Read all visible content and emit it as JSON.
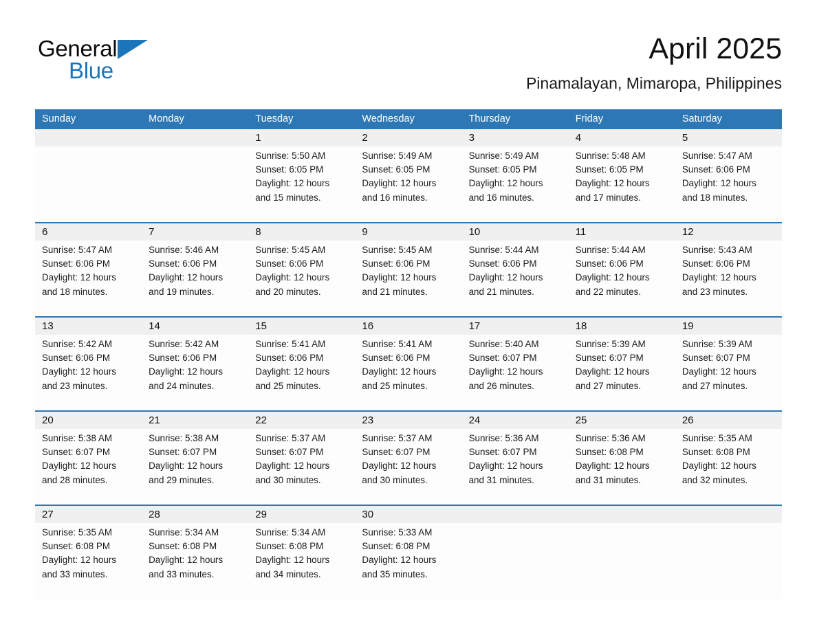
{
  "brand": {
    "name_part1": "General",
    "name_part2": "Blue",
    "triangle_icon": "triangle-icon",
    "color_black": "#0b0b0b",
    "color_blue": "#1b75bb"
  },
  "header": {
    "title": "April 2025",
    "subtitle": "Pinamalayan, Mimaropa, Philippines"
  },
  "theme": {
    "header_bg": "#2e77b5",
    "header_text": "#ffffff",
    "datestrip_bg": "#f0f0f0",
    "cell_bg": "#fdfdfd",
    "rule_color": "#2e77b5"
  },
  "weekdays": [
    "Sunday",
    "Monday",
    "Tuesday",
    "Wednesday",
    "Thursday",
    "Friday",
    "Saturday"
  ],
  "weeks": [
    {
      "days": [
        {
          "num": "",
          "lines": []
        },
        {
          "num": "",
          "lines": []
        },
        {
          "num": "1",
          "lines": [
            "Sunrise: 5:50 AM",
            "Sunset: 6:05 PM",
            "Daylight: 12 hours",
            "and 15 minutes."
          ]
        },
        {
          "num": "2",
          "lines": [
            "Sunrise: 5:49 AM",
            "Sunset: 6:05 PM",
            "Daylight: 12 hours",
            "and 16 minutes."
          ]
        },
        {
          "num": "3",
          "lines": [
            "Sunrise: 5:49 AM",
            "Sunset: 6:05 PM",
            "Daylight: 12 hours",
            "and 16 minutes."
          ]
        },
        {
          "num": "4",
          "lines": [
            "Sunrise: 5:48 AM",
            "Sunset: 6:05 PM",
            "Daylight: 12 hours",
            "and 17 minutes."
          ]
        },
        {
          "num": "5",
          "lines": [
            "Sunrise: 5:47 AM",
            "Sunset: 6:06 PM",
            "Daylight: 12 hours",
            "and 18 minutes."
          ]
        }
      ]
    },
    {
      "days": [
        {
          "num": "6",
          "lines": [
            "Sunrise: 5:47 AM",
            "Sunset: 6:06 PM",
            "Daylight: 12 hours",
            "and 18 minutes."
          ]
        },
        {
          "num": "7",
          "lines": [
            "Sunrise: 5:46 AM",
            "Sunset: 6:06 PM",
            "Daylight: 12 hours",
            "and 19 minutes."
          ]
        },
        {
          "num": "8",
          "lines": [
            "Sunrise: 5:45 AM",
            "Sunset: 6:06 PM",
            "Daylight: 12 hours",
            "and 20 minutes."
          ]
        },
        {
          "num": "9",
          "lines": [
            "Sunrise: 5:45 AM",
            "Sunset: 6:06 PM",
            "Daylight: 12 hours",
            "and 21 minutes."
          ]
        },
        {
          "num": "10",
          "lines": [
            "Sunrise: 5:44 AM",
            "Sunset: 6:06 PM",
            "Daylight: 12 hours",
            "and 21 minutes."
          ]
        },
        {
          "num": "11",
          "lines": [
            "Sunrise: 5:44 AM",
            "Sunset: 6:06 PM",
            "Daylight: 12 hours",
            "and 22 minutes."
          ]
        },
        {
          "num": "12",
          "lines": [
            "Sunrise: 5:43 AM",
            "Sunset: 6:06 PM",
            "Daylight: 12 hours",
            "and 23 minutes."
          ]
        }
      ]
    },
    {
      "days": [
        {
          "num": "13",
          "lines": [
            "Sunrise: 5:42 AM",
            "Sunset: 6:06 PM",
            "Daylight: 12 hours",
            "and 23 minutes."
          ]
        },
        {
          "num": "14",
          "lines": [
            "Sunrise: 5:42 AM",
            "Sunset: 6:06 PM",
            "Daylight: 12 hours",
            "and 24 minutes."
          ]
        },
        {
          "num": "15",
          "lines": [
            "Sunrise: 5:41 AM",
            "Sunset: 6:06 PM",
            "Daylight: 12 hours",
            "and 25 minutes."
          ]
        },
        {
          "num": "16",
          "lines": [
            "Sunrise: 5:41 AM",
            "Sunset: 6:06 PM",
            "Daylight: 12 hours",
            "and 25 minutes."
          ]
        },
        {
          "num": "17",
          "lines": [
            "Sunrise: 5:40 AM",
            "Sunset: 6:07 PM",
            "Daylight: 12 hours",
            "and 26 minutes."
          ]
        },
        {
          "num": "18",
          "lines": [
            "Sunrise: 5:39 AM",
            "Sunset: 6:07 PM",
            "Daylight: 12 hours",
            "and 27 minutes."
          ]
        },
        {
          "num": "19",
          "lines": [
            "Sunrise: 5:39 AM",
            "Sunset: 6:07 PM",
            "Daylight: 12 hours",
            "and 27 minutes."
          ]
        }
      ]
    },
    {
      "days": [
        {
          "num": "20",
          "lines": [
            "Sunrise: 5:38 AM",
            "Sunset: 6:07 PM",
            "Daylight: 12 hours",
            "and 28 minutes."
          ]
        },
        {
          "num": "21",
          "lines": [
            "Sunrise: 5:38 AM",
            "Sunset: 6:07 PM",
            "Daylight: 12 hours",
            "and 29 minutes."
          ]
        },
        {
          "num": "22",
          "lines": [
            "Sunrise: 5:37 AM",
            "Sunset: 6:07 PM",
            "Daylight: 12 hours",
            "and 30 minutes."
          ]
        },
        {
          "num": "23",
          "lines": [
            "Sunrise: 5:37 AM",
            "Sunset: 6:07 PM",
            "Daylight: 12 hours",
            "and 30 minutes."
          ]
        },
        {
          "num": "24",
          "lines": [
            "Sunrise: 5:36 AM",
            "Sunset: 6:07 PM",
            "Daylight: 12 hours",
            "and 31 minutes."
          ]
        },
        {
          "num": "25",
          "lines": [
            "Sunrise: 5:36 AM",
            "Sunset: 6:08 PM",
            "Daylight: 12 hours",
            "and 31 minutes."
          ]
        },
        {
          "num": "26",
          "lines": [
            "Sunrise: 5:35 AM",
            "Sunset: 6:08 PM",
            "Daylight: 12 hours",
            "and 32 minutes."
          ]
        }
      ]
    },
    {
      "days": [
        {
          "num": "27",
          "lines": [
            "Sunrise: 5:35 AM",
            "Sunset: 6:08 PM",
            "Daylight: 12 hours",
            "and 33 minutes."
          ]
        },
        {
          "num": "28",
          "lines": [
            "Sunrise: 5:34 AM",
            "Sunset: 6:08 PM",
            "Daylight: 12 hours",
            "and 33 minutes."
          ]
        },
        {
          "num": "29",
          "lines": [
            "Sunrise: 5:34 AM",
            "Sunset: 6:08 PM",
            "Daylight: 12 hours",
            "and 34 minutes."
          ]
        },
        {
          "num": "30",
          "lines": [
            "Sunrise: 5:33 AM",
            "Sunset: 6:08 PM",
            "Daylight: 12 hours",
            "and 35 minutes."
          ]
        },
        {
          "num": "",
          "lines": []
        },
        {
          "num": "",
          "lines": []
        },
        {
          "num": "",
          "lines": []
        }
      ]
    }
  ]
}
